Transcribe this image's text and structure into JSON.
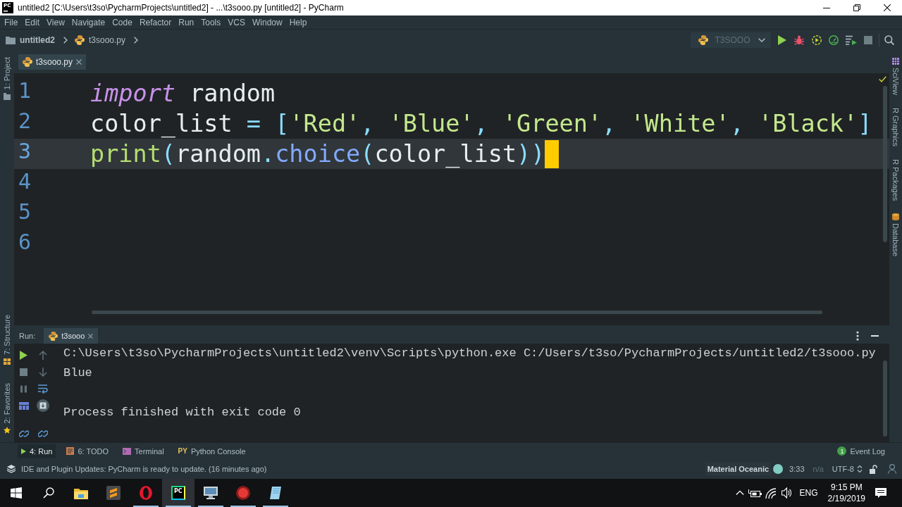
{
  "window": {
    "logo": "PC",
    "title": "untitled2 [C:\\Users\\t3so\\PycharmProjects\\untitled2] - ...\\t3sooo.py [untitled2] - PyCharm"
  },
  "menu": [
    "File",
    "Edit",
    "View",
    "Navigate",
    "Code",
    "Refactor",
    "Run",
    "Tools",
    "VCS",
    "Window",
    "Help"
  ],
  "navbar": {
    "crumbs": [
      {
        "kind": "folder",
        "label": "untitled2"
      },
      {
        "kind": "python",
        "label": "t3sooo.py"
      }
    ],
    "run_config": "T3SOOO"
  },
  "left_stripe": {
    "top": [
      {
        "kind": "project",
        "label": "1: Project"
      }
    ],
    "bottom": [
      {
        "kind": "structure",
        "label": "7: Structure"
      },
      {
        "kind": "favorites",
        "label": "2: Favorites"
      }
    ]
  },
  "editor": {
    "tabs": [
      {
        "label": "t3sooo.py",
        "selected": true
      }
    ],
    "lines": [
      {
        "number": "1",
        "current": false,
        "tokens": [
          {
            "kind": "keyword",
            "text": "import"
          },
          {
            "kind": "plain",
            "text": " random"
          }
        ]
      },
      {
        "number": "2",
        "current": false,
        "tokens": [
          {
            "kind": "plain",
            "text": "color_list "
          },
          {
            "kind": "operator",
            "text": "= ["
          },
          {
            "kind": "string",
            "text": "'Red'"
          },
          {
            "kind": "operator",
            "text": ", "
          },
          {
            "kind": "string",
            "text": "'Blue'"
          },
          {
            "kind": "operator",
            "text": ", "
          },
          {
            "kind": "string",
            "text": "'Green'"
          },
          {
            "kind": "operator",
            "text": ", "
          },
          {
            "kind": "string",
            "text": "'White'"
          },
          {
            "kind": "operator",
            "text": ", "
          },
          {
            "kind": "string",
            "text": "'Black'"
          },
          {
            "kind": "operator",
            "text": "]"
          }
        ]
      },
      {
        "number": "3",
        "current": true,
        "tokens": [
          {
            "kind": "builtin",
            "text": "print"
          },
          {
            "kind": "operator",
            "text": "("
          },
          {
            "kind": "plain",
            "text": "random"
          },
          {
            "kind": "operator",
            "text": "."
          },
          {
            "kind": "method",
            "text": "choice"
          },
          {
            "kind": "operator",
            "text": "("
          },
          {
            "kind": "plain",
            "text": "color_list"
          },
          {
            "kind": "operator",
            "text": "))"
          }
        ]
      },
      {
        "number": "4",
        "current": false
      },
      {
        "number": "5",
        "current": false
      },
      {
        "number": "6",
        "current": false
      }
    ]
  },
  "right_stripe": [
    {
      "kind": "sciview",
      "label": "SciView"
    },
    {
      "kind": "plain",
      "label": "R Graphics"
    },
    {
      "kind": "plain",
      "label": "R Packages"
    },
    {
      "kind": "database",
      "label": "Database"
    }
  ],
  "run_panel": {
    "title": "Run:",
    "tabs": [
      {
        "label": "t3sooo",
        "selected": true
      }
    ],
    "console": {
      "command": "C:\\Users\\t3so\\PycharmProjects\\untitled2\\venv\\Scripts\\python.exe C:/Users/t3so/PycharmProjects/untitled2/t3sooo.py",
      "output": [
        "Blue"
      ],
      "exit_message": "Process finished with exit code 0"
    }
  },
  "tool_windows": [
    {
      "kind": "run",
      "label": "4: Run",
      "selected": true
    },
    {
      "kind": "todo",
      "label": "6: TODO",
      "selected": false
    },
    {
      "kind": "terminal",
      "label": "Terminal",
      "selected": false
    },
    {
      "kind": "python_console",
      "logo": "PY",
      "label": "Python Console",
      "selected": false
    }
  ],
  "event_log": {
    "count": "1",
    "label": "Event Log"
  },
  "status_bar": {
    "message": "IDE and Plugin Updates: PyCharm is ready to update. (16 minutes ago)",
    "theme": "Material Oceanic",
    "position": "3:33",
    "context": "n/a",
    "encoding": "UTF-8"
  },
  "taskbar": {
    "apps": [
      {
        "kind": "folder",
        "running": false,
        "selected": false
      },
      {
        "kind": "editor",
        "running": false,
        "selected": false
      },
      {
        "kind": "browser",
        "running": true,
        "selected": false
      },
      {
        "kind": "ide",
        "logo": "PC",
        "running": true,
        "selected": true
      },
      {
        "kind": "monitor",
        "running": true,
        "selected": false
      },
      {
        "kind": "recorder",
        "running": true,
        "selected": false
      },
      {
        "kind": "notes",
        "running": true,
        "selected": false
      }
    ],
    "language": "ENG",
    "time": "9:15 PM",
    "date": "2/19/2019"
  }
}
